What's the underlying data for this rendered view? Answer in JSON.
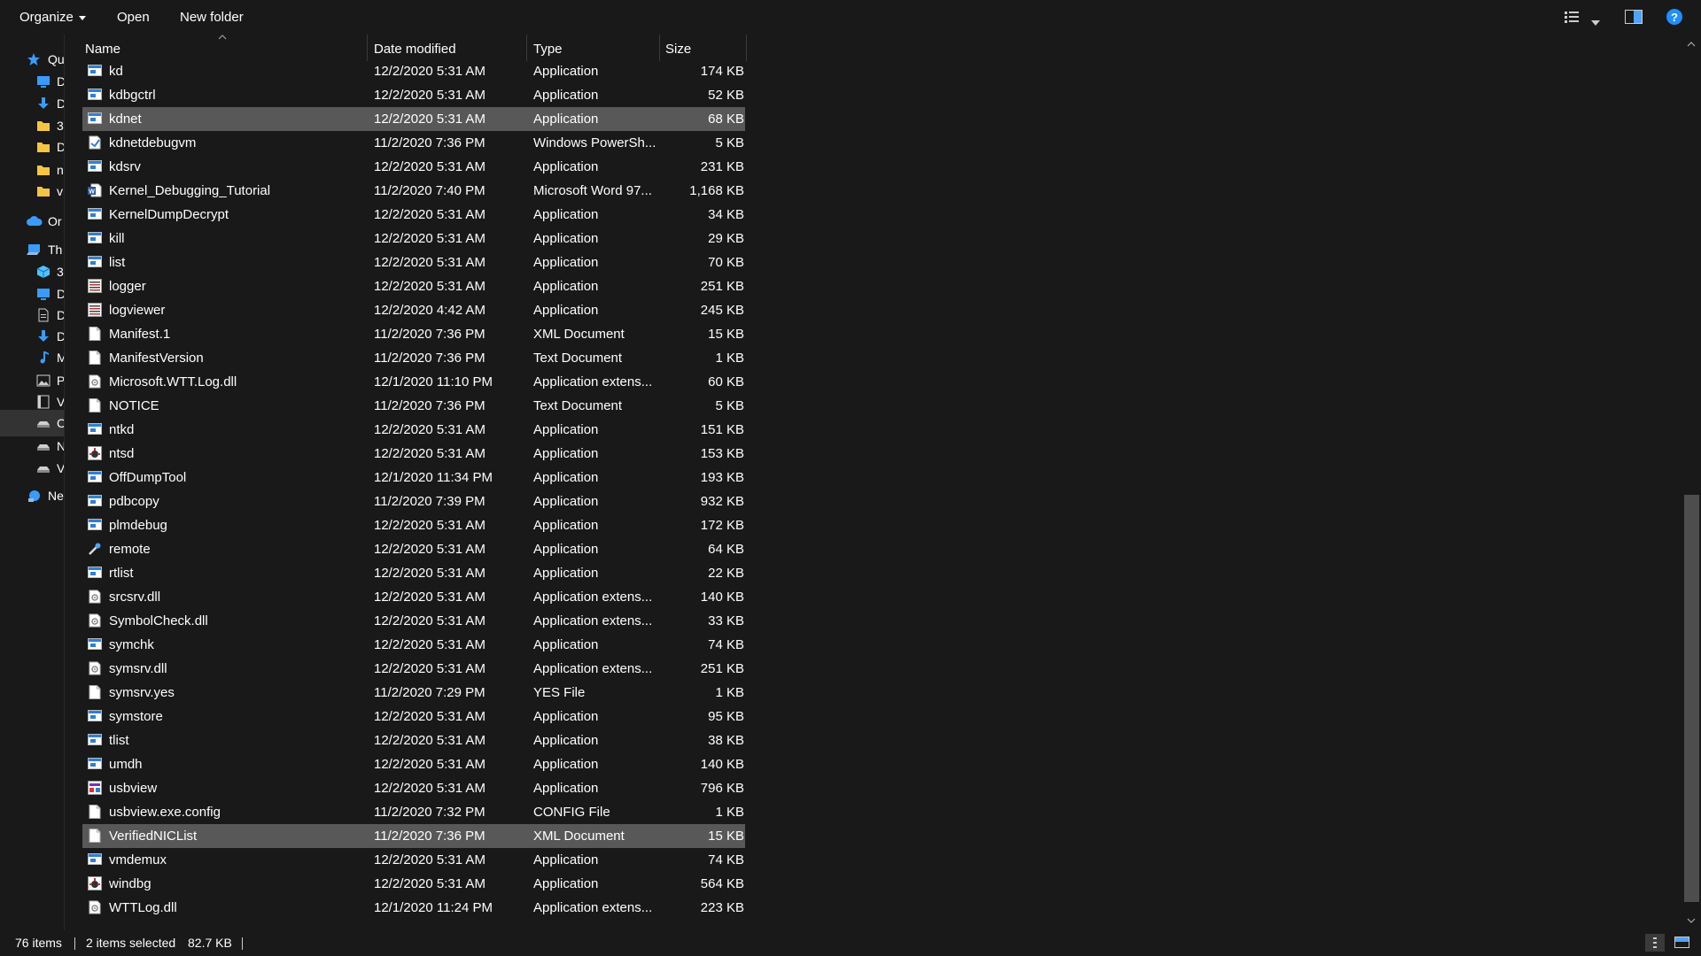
{
  "toolbar": {
    "organize_label": "Organize",
    "open_label": "Open",
    "new_folder_label": "New folder"
  },
  "nav": {
    "items": [
      {
        "label": "Qu",
        "icon": "star-icon",
        "color": "#3a9bff"
      },
      {
        "label": "D",
        "icon": "desktop-icon",
        "color": "#3a9bff"
      },
      {
        "label": "D",
        "icon": "download-arrow-icon",
        "color": "#3a9bff"
      },
      {
        "label": "3",
        "icon": "folder-icon",
        "color": "#f5c542"
      },
      {
        "label": "D",
        "icon": "folder-icon",
        "color": "#f5c542"
      },
      {
        "label": "n",
        "icon": "folder-icon",
        "color": "#f5c542"
      },
      {
        "label": "v",
        "icon": "folder-icon",
        "color": "#f5c542"
      },
      {
        "label": "Or",
        "icon": "cloud-icon",
        "color": "#3a9bff"
      },
      {
        "label": "Th",
        "icon": "computer-icon",
        "color": "#3a9bff"
      },
      {
        "label": "3",
        "icon": "cube-icon",
        "color": "#4cc2ff"
      },
      {
        "label": "D",
        "icon": "desktop-icon",
        "color": "#3a9bff"
      },
      {
        "label": "D",
        "icon": "document-icon",
        "color": "#cfcfcf"
      },
      {
        "label": "D",
        "icon": "download-arrow-icon",
        "color": "#3a9bff"
      },
      {
        "label": "M",
        "icon": "music-note-icon",
        "color": "#3a9bff"
      },
      {
        "label": "P",
        "icon": "picture-icon",
        "color": "#cfcfcf"
      },
      {
        "label": "V",
        "icon": "video-icon",
        "color": "#cfcfcf"
      },
      {
        "label": "C",
        "icon": "drive-icon",
        "color": "#cfcfcf"
      },
      {
        "label": "N",
        "icon": "drive-icon",
        "color": "#cfcfcf"
      },
      {
        "label": "V",
        "icon": "drive-icon",
        "color": "#cfcfcf"
      },
      {
        "label": "Ne",
        "icon": "network-icon",
        "color": "#3a9bff"
      }
    ]
  },
  "columns": {
    "name": "Name",
    "date": "Date modified",
    "type": "Type",
    "size": "Size"
  },
  "files": [
    {
      "name": "kd",
      "date": "12/2/2020 5:31 AM",
      "type": "Application",
      "size": "174 KB",
      "icon": "app",
      "selected": false
    },
    {
      "name": "kdbgctrl",
      "date": "12/2/2020 5:31 AM",
      "type": "Application",
      "size": "52 KB",
      "icon": "app",
      "selected": false
    },
    {
      "name": "kdnet",
      "date": "12/2/2020 5:31 AM",
      "type": "Application",
      "size": "68 KB",
      "icon": "app",
      "selected": true
    },
    {
      "name": "kdnetdebugvm",
      "date": "11/2/2020 7:36 PM",
      "type": "Windows PowerSh...",
      "size": "5 KB",
      "icon": "script",
      "selected": false
    },
    {
      "name": "kdsrv",
      "date": "12/2/2020 5:31 AM",
      "type": "Application",
      "size": "231 KB",
      "icon": "app",
      "selected": false
    },
    {
      "name": "Kernel_Debugging_Tutorial",
      "date": "11/2/2020 7:40 PM",
      "type": "Microsoft Word 97...",
      "size": "1,168 KB",
      "icon": "word",
      "selected": false
    },
    {
      "name": "KernelDumpDecrypt",
      "date": "12/2/2020 5:31 AM",
      "type": "Application",
      "size": "34 KB",
      "icon": "app",
      "selected": false
    },
    {
      "name": "kill",
      "date": "12/2/2020 5:31 AM",
      "type": "Application",
      "size": "29 KB",
      "icon": "app",
      "selected": false
    },
    {
      "name": "list",
      "date": "12/2/2020 5:31 AM",
      "type": "Application",
      "size": "70 KB",
      "icon": "app",
      "selected": false
    },
    {
      "name": "logger",
      "date": "12/2/2020 5:31 AM",
      "type": "Application",
      "size": "251 KB",
      "icon": "log",
      "selected": false
    },
    {
      "name": "logviewer",
      "date": "12/2/2020 4:42 AM",
      "type": "Application",
      "size": "245 KB",
      "icon": "log",
      "selected": false
    },
    {
      "name": "Manifest.1",
      "date": "11/2/2020 7:36 PM",
      "type": "XML Document",
      "size": "15 KB",
      "icon": "doc",
      "selected": false
    },
    {
      "name": "ManifestVersion",
      "date": "11/2/2020 7:36 PM",
      "type": "Text Document",
      "size": "1 KB",
      "icon": "doc",
      "selected": false
    },
    {
      "name": "Microsoft.WTT.Log.dll",
      "date": "12/1/2020 11:10 PM",
      "type": "Application extens...",
      "size": "60 KB",
      "icon": "dll",
      "selected": false
    },
    {
      "name": "NOTICE",
      "date": "11/2/2020 7:36 PM",
      "type": "Text Document",
      "size": "5 KB",
      "icon": "doc",
      "selected": false
    },
    {
      "name": "ntkd",
      "date": "12/2/2020 5:31 AM",
      "type": "Application",
      "size": "151 KB",
      "icon": "app",
      "selected": false
    },
    {
      "name": "ntsd",
      "date": "12/2/2020 5:31 AM",
      "type": "Application",
      "size": "153 KB",
      "icon": "debug",
      "selected": false
    },
    {
      "name": "OffDumpTool",
      "date": "12/1/2020 11:34 PM",
      "type": "Application",
      "size": "193 KB",
      "icon": "app",
      "selected": false
    },
    {
      "name": "pdbcopy",
      "date": "11/2/2020 7:39 PM",
      "type": "Application",
      "size": "932 KB",
      "icon": "app",
      "selected": false
    },
    {
      "name": "plmdebug",
      "date": "12/2/2020 5:31 AM",
      "type": "Application",
      "size": "172 KB",
      "icon": "app",
      "selected": false
    },
    {
      "name": "remote",
      "date": "12/2/2020 5:31 AM",
      "type": "Application",
      "size": "64 KB",
      "icon": "remote",
      "selected": false
    },
    {
      "name": "rtlist",
      "date": "12/2/2020 5:31 AM",
      "type": "Application",
      "size": "22 KB",
      "icon": "app",
      "selected": false
    },
    {
      "name": "srcsrv.dll",
      "date": "12/2/2020 5:31 AM",
      "type": "Application extens...",
      "size": "140 KB",
      "icon": "dll",
      "selected": false
    },
    {
      "name": "SymbolCheck.dll",
      "date": "12/2/2020 5:31 AM",
      "type": "Application extens...",
      "size": "33 KB",
      "icon": "dll",
      "selected": false
    },
    {
      "name": "symchk",
      "date": "12/2/2020 5:31 AM",
      "type": "Application",
      "size": "74 KB",
      "icon": "app",
      "selected": false
    },
    {
      "name": "symsrv.dll",
      "date": "12/2/2020 5:31 AM",
      "type": "Application extens...",
      "size": "251 KB",
      "icon": "dll",
      "selected": false
    },
    {
      "name": "symsrv.yes",
      "date": "11/2/2020 7:29 PM",
      "type": "YES File",
      "size": "1 KB",
      "icon": "doc",
      "selected": false
    },
    {
      "name": "symstore",
      "date": "12/2/2020 5:31 AM",
      "type": "Application",
      "size": "95 KB",
      "icon": "app",
      "selected": false
    },
    {
      "name": "tlist",
      "date": "12/2/2020 5:31 AM",
      "type": "Application",
      "size": "38 KB",
      "icon": "app",
      "selected": false
    },
    {
      "name": "umdh",
      "date": "12/2/2020 5:31 AM",
      "type": "Application",
      "size": "140 KB",
      "icon": "app",
      "selected": false
    },
    {
      "name": "usbview",
      "date": "12/2/2020 5:31 AM",
      "type": "Application",
      "size": "796 KB",
      "icon": "usb",
      "selected": false
    },
    {
      "name": "usbview.exe.config",
      "date": "11/2/2020 7:32 PM",
      "type": "CONFIG File",
      "size": "1 KB",
      "icon": "doc",
      "selected": false
    },
    {
      "name": "VerifiedNICList",
      "date": "11/2/2020 7:36 PM",
      "type": "XML Document",
      "size": "15 KB",
      "icon": "doc",
      "selected": true
    },
    {
      "name": "vmdemux",
      "date": "12/2/2020 5:31 AM",
      "type": "Application",
      "size": "74 KB",
      "icon": "app",
      "selected": false
    },
    {
      "name": "windbg",
      "date": "12/2/2020 5:31 AM",
      "type": "Application",
      "size": "564 KB",
      "icon": "debug",
      "selected": false
    },
    {
      "name": "WTTLog.dll",
      "date": "12/1/2020 11:24 PM",
      "type": "Application extens...",
      "size": "223 KB",
      "icon": "dll",
      "selected": false
    }
  ],
  "status": {
    "item_count": "76 items",
    "selection": "2 items selected",
    "selection_size": "82.7 KB"
  },
  "colors": {
    "background": "#191919",
    "selection": "#777777",
    "accent": "#3a9bff",
    "help": "#1e90ff"
  }
}
